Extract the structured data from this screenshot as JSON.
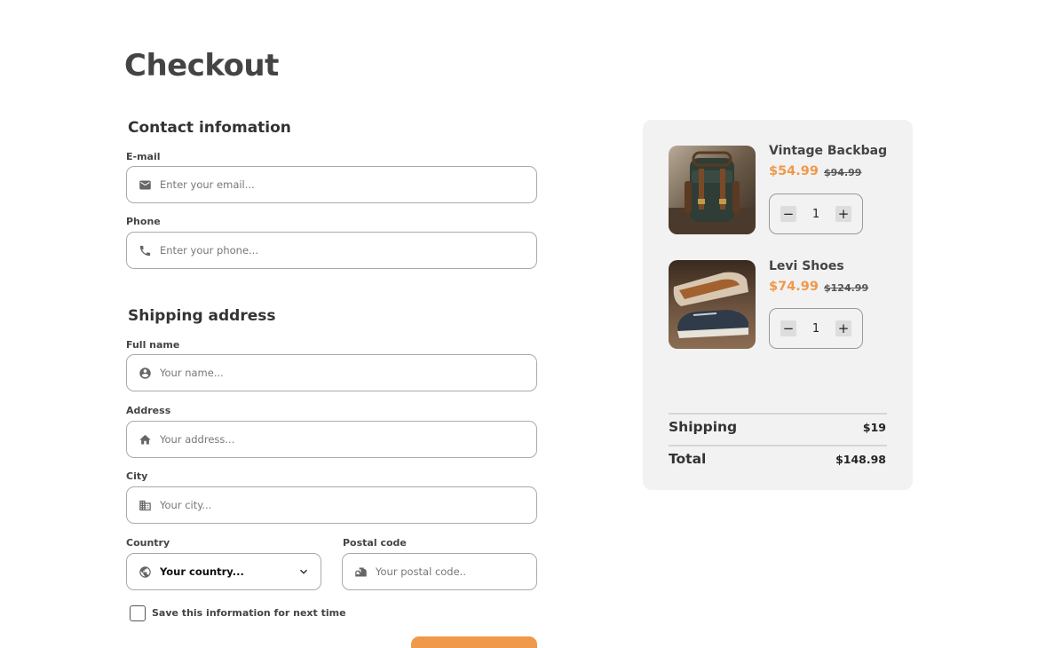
{
  "page": {
    "title": "Checkout"
  },
  "contact": {
    "heading": "Contact infomation",
    "email": {
      "label": "E-mail",
      "placeholder": "Enter your email...",
      "icon": "mail-icon"
    },
    "phone": {
      "label": "Phone",
      "placeholder": "Enter your phone...",
      "icon": "phone-icon"
    }
  },
  "shipping": {
    "heading": "Shipping address",
    "full_name": {
      "label": "Full name",
      "placeholder": "Your name...",
      "icon": "user-icon"
    },
    "address": {
      "label": "Address",
      "placeholder": "Your address...",
      "icon": "home-icon"
    },
    "city": {
      "label": "City",
      "placeholder": "Your city...",
      "icon": "building-icon"
    },
    "country": {
      "label": "Country",
      "value": "Your country...",
      "icon": "globe-icon"
    },
    "postal": {
      "label": "Postal code",
      "placeholder": "Your postal code..",
      "icon": "mailbox-icon"
    },
    "save_label": "Save this information for next time"
  },
  "colors": {
    "accent": "#f0994a",
    "panel": "#f2f2f2"
  },
  "cart": {
    "items": [
      {
        "name": "Vintage Backbag",
        "price": "$54.99",
        "old_price": "$94.99",
        "qty": "1"
      },
      {
        "name": "Levi Shoes",
        "price": "$74.99",
        "old_price": "$124.99",
        "qty": "1"
      }
    ],
    "qty_minus": "−",
    "qty_plus": "+",
    "shipping_label": "Shipping",
    "shipping_value": "$19",
    "total_label": "Total",
    "total_value": "$148.98"
  }
}
